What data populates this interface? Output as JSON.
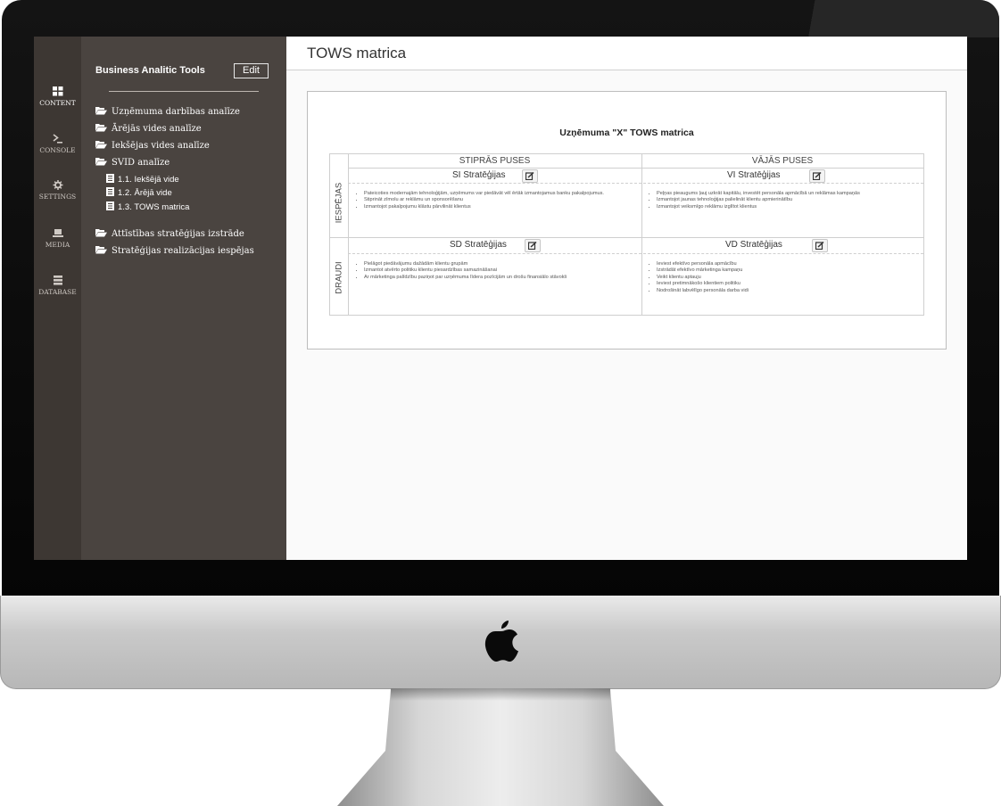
{
  "sidebar": {
    "brand": "Business Analitic Tools",
    "edit_label": "Edit",
    "nav": [
      {
        "label": "Uzņēmuma darbības analīze",
        "icon": "folder-open-icon"
      },
      {
        "label": "Ārējās vides analīze",
        "icon": "folder-open-icon"
      },
      {
        "label": "Iekšējas vides analīze",
        "icon": "folder-open-icon"
      },
      {
        "label": "SVID analīze",
        "icon": "folder-open-icon"
      }
    ],
    "sub": [
      {
        "label": "1.1. Iekšējā vide",
        "icon": "list-doc-icon"
      },
      {
        "label": "1.2. Ārējā vide",
        "icon": "list-doc-icon"
      },
      {
        "label": "1.3. TOWS matrica",
        "icon": "list-doc-icon"
      }
    ],
    "nav2": [
      {
        "label": "Attīstības stratēģijas izstrāde",
        "icon": "folder-open-icon"
      },
      {
        "label": "Stratēģijas realizācijas iespējas",
        "icon": "folder-open-icon"
      }
    ]
  },
  "iconbar": [
    {
      "label": "CONTENT",
      "icon": "grid-icon",
      "active": true
    },
    {
      "label": "CONSOLE",
      "icon": "terminal-icon"
    },
    {
      "label": "SETTINGS",
      "icon": "gear-icon"
    },
    {
      "label": "MEDIA",
      "icon": "laptop-icon"
    },
    {
      "label": "DATABASE",
      "icon": "database-icon"
    }
  ],
  "page": {
    "title": "TOWS matrica",
    "matrix_title": "Uzņēmuma \"X\" TOWS matrica"
  },
  "matrix": {
    "col_heads": [
      "STIPRĀS PUSES",
      "VĀJĀS PUSES"
    ],
    "row_heads": [
      "IESPĒJAS",
      "DRAUDI"
    ],
    "cells": {
      "si": {
        "label": "SI Stratēģijas",
        "items": [
          "Pateicoties modernajām tehnoloģijām, uzņēmums var piedāvāt vēl ērtāk izmantojamus banku pakalpojumus.",
          "Stiprināt zīmolu ar reklāmu un sponsorēšanu",
          "Izmantojot pakalpojumu klāstu pārvilināt klientus"
        ]
      },
      "vi": {
        "label": "VI Stratēģijas",
        "items": [
          "Peļņas pieaugums ļauj uzkrāt kapitālu, investēt personāla apmācībā un reklāmas kampaņās",
          "Izmantojot jaunas tehnoloģijas palielināt klientu apmierinātību",
          "Izmantojot veiksmīgo reklāmu izglītot klientus"
        ]
      },
      "sd": {
        "label": "SD Stratēģijas",
        "items": [
          "Pielāgot piedāvājumu dažādām klientu grupām",
          "Izmantot atvērto politiku klientu piesardzības samazināšanai",
          "Ar mārketinga palīdzību paziņot par uzņēmuma līdera pozīcijām un drošu finansiālo stāvokli"
        ]
      },
      "vd": {
        "label": "VD Stratēģijas",
        "items": [
          "Ieviest efektīvo personāla apmācību",
          "Izstrādāt efektīvo mārketinga kampaņu",
          "Veikt klientu aptauju",
          "Ieviest pretimnākošo klientiem politiku",
          "Nodrošināt labvēlīgo personāla darba vidi"
        ]
      }
    }
  }
}
